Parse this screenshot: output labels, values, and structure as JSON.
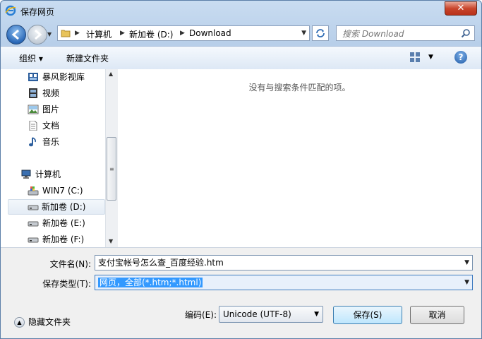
{
  "window": {
    "title": "保存网页",
    "close": "✕"
  },
  "nav": {
    "breadcrumbs": [
      "计算机",
      "新加卷 (D:)",
      "Download"
    ],
    "search_placeholder": "搜索 Download"
  },
  "toolbar": {
    "organize": "组织 ▾",
    "new_folder": "新建文件夹",
    "help": "?"
  },
  "sidebar": {
    "items": [
      {
        "label": "暴风影视库",
        "icon": "video-library-icon"
      },
      {
        "label": "视频",
        "icon": "film-icon"
      },
      {
        "label": "图片",
        "icon": "picture-icon"
      },
      {
        "label": "文档",
        "icon": "document-icon"
      },
      {
        "label": "音乐",
        "icon": "music-icon"
      },
      {
        "label": "计算机",
        "icon": "computer-icon"
      },
      {
        "label": "WIN7 (C:)",
        "icon": "system-drive-icon"
      },
      {
        "label": "新加卷 (D:)",
        "icon": "drive-icon"
      },
      {
        "label": "新加卷 (E:)",
        "icon": "drive-icon"
      },
      {
        "label": "新加卷 (F:)",
        "icon": "drive-icon"
      }
    ],
    "selected": "新加卷 (D:)"
  },
  "file_list": {
    "empty_message": "没有与搜索条件匹配的项。"
  },
  "form": {
    "filename_label": "文件名(N):",
    "filename_value": "支付宝帐号怎么查_百度经验.htm",
    "filetype_label": "保存类型(T):",
    "filetype_value": "网页，全部(*.htm;*.html)",
    "hide_folders": "隐藏文件夹",
    "encoding_label": "编码(E):",
    "encoding_value": "Unicode (UTF-8)",
    "save_button": "保存(S)",
    "cancel_button": "取消"
  }
}
